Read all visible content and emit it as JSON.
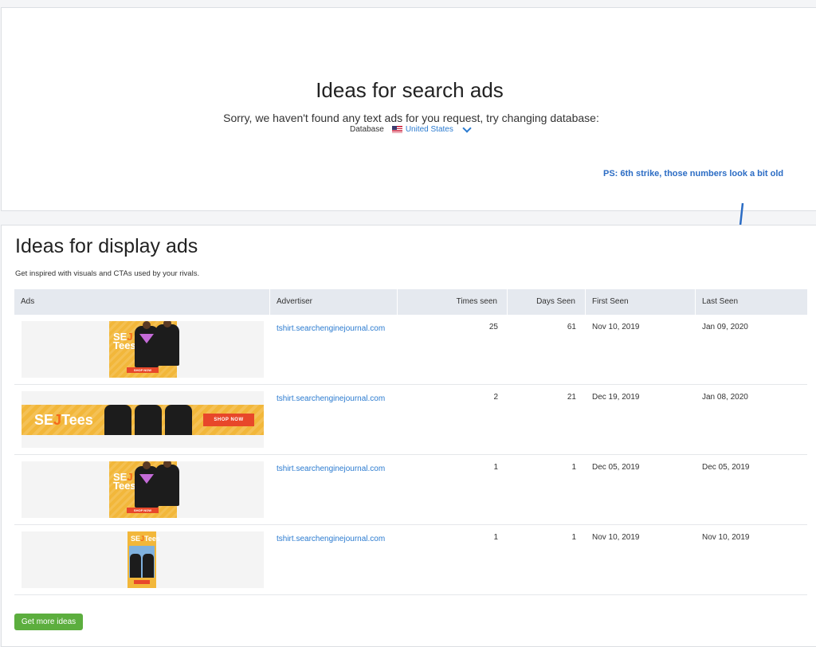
{
  "search_ads": {
    "title": "Ideas for search ads",
    "message": "Sorry, we haven't found any text ads for you request, try changing database:",
    "database_label": "Database",
    "database_value": "United States",
    "flag_icon": "us-flag-icon"
  },
  "annotation": {
    "note": "PS: 6th strike, those numbers look a bit old",
    "color": "#2b6cc4"
  },
  "display_ads": {
    "title": "Ideas for display ads",
    "description": "Get inspired with visuals and CTAs used by your rivals.",
    "columns": [
      "Ads",
      "Advertiser",
      "Times seen",
      "Days Seen",
      "First Seen",
      "Last Seen"
    ],
    "rows": [
      {
        "ad_type": "square",
        "advertiser": "tshirt.searchenginejournal.com",
        "times_seen": "25",
        "days_seen": "61",
        "first_seen": "Nov 10, 2019",
        "last_seen": "Jan 09, 2020"
      },
      {
        "ad_type": "wide",
        "advertiser": "tshirt.searchenginejournal.com",
        "times_seen": "2",
        "days_seen": "21",
        "first_seen": "Dec 19, 2019",
        "last_seen": "Jan 08, 2020"
      },
      {
        "ad_type": "square",
        "advertiser": "tshirt.searchenginejournal.com",
        "times_seen": "1",
        "days_seen": "1",
        "first_seen": "Dec 05, 2019",
        "last_seen": "Dec 05, 2019"
      },
      {
        "ad_type": "tall",
        "advertiser": "tshirt.searchenginejournal.com",
        "times_seen": "1",
        "days_seen": "1",
        "first_seen": "Nov 10, 2019",
        "last_seen": "Nov 10, 2019"
      }
    ],
    "ad_creative": {
      "logo_se": "SE",
      "logo_j": "J",
      "logo_tees": "Tees",
      "cta": "SHOP NOW"
    },
    "more_button": "Get more ideas"
  },
  "colors": {
    "link": "#2b7bd0",
    "button": "#5cae3e",
    "header_bg": "#e5e9ef",
    "ad_yellow": "#f2b73a",
    "ad_cta": "#e8472a"
  }
}
